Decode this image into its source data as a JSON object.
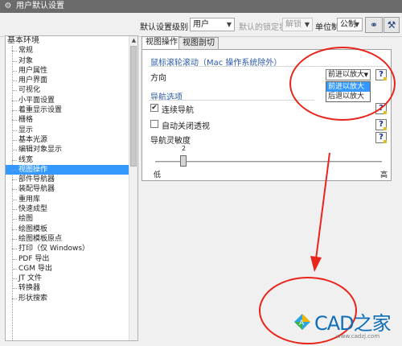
{
  "window": {
    "title": "用户默认设置"
  },
  "toolbar": {
    "level_label": "默认设置级别",
    "level_value": "用户",
    "lock_label": "默认的锁定状态",
    "lock_value": "解锁",
    "unit_label": "单位制",
    "unit_value": "公制"
  },
  "tree": {
    "root": "基本环境",
    "items": [
      "常规",
      "对象",
      "用户属性",
      "用户界面",
      "可视化",
      "小平面设置",
      "着重显示设置",
      "栅格",
      "显示",
      "基本光源",
      "编辑对象显示",
      "线宽",
      "视图操作",
      "部件导航器",
      "装配导航器",
      "重用库",
      "快速成型",
      "绘图",
      "绘图模板",
      "绘图模板原点",
      "打印（仅 Windows）",
      "PDF 导出",
      "CGM 导出",
      "JT 文件",
      "转换器",
      "形状搜索"
    ],
    "selected_index": 12
  },
  "tabs": [
    "视图操作",
    "视图剖切"
  ],
  "mouse_wheel": {
    "title": "鼠标滚轮滚动（Mac 操作系统除外）",
    "direction_label": "方向",
    "direction_value": "前进以放大",
    "options": [
      "前进以放大",
      "后退以放大"
    ],
    "highlighted_option": 0
  },
  "navigation": {
    "title": "导航选项",
    "continuous_label": "连续导航",
    "continuous_checked": true,
    "auto_close_label": "自动关闭透视",
    "auto_close_checked": false,
    "sensitivity_label": "导航灵敏度",
    "slider_value": "2",
    "slider_low": "低",
    "slider_high": "高"
  },
  "watermark": {
    "text": "CAD之家",
    "sub": "www.cadzj.com"
  },
  "colors": {
    "accent": "#3399ff",
    "annotation": "#e8241c",
    "titlebar": "#6b6b6b",
    "watermark": "#0e6eb8"
  },
  "icons": {
    "title_icon": "gear-icon",
    "help_icon": "help-icon",
    "watermark_icon": "cad-logo-icon"
  }
}
